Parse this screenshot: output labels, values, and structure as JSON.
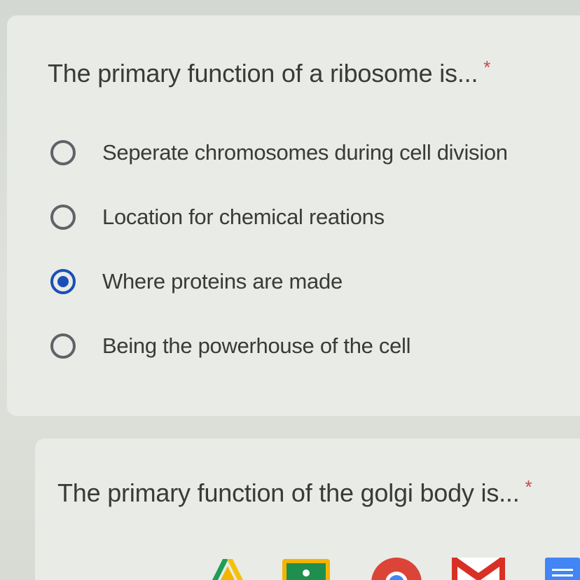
{
  "questions": [
    {
      "title": "The primary function of a ribosome is...",
      "required_mark": "*",
      "options": [
        {
          "label": "Seperate chromosomes during cell division",
          "selected": false
        },
        {
          "label": "Location for chemical reations",
          "selected": false
        },
        {
          "label": "Where proteins are made",
          "selected": true
        },
        {
          "label": "Being the powerhouse of the cell",
          "selected": false
        }
      ]
    },
    {
      "title": "The primary function of the golgi body is...",
      "required_mark": "*"
    }
  ],
  "colors": {
    "required": "#c94a43",
    "radio_selected": "#1a4fb8",
    "radio_unselected": "#5f6368",
    "text": "#3a3a38"
  },
  "shelf": {
    "icons": [
      "google-drive-icon",
      "google-classroom-icon",
      "chrome-icon",
      "gmail-icon",
      "google-docs-icon"
    ]
  }
}
